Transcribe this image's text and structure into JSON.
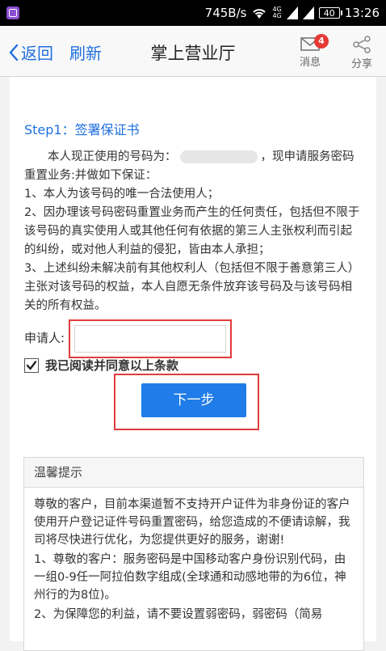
{
  "status_bar": {
    "speed": "745B/s",
    "network_4g_top": "4G",
    "network_4g_bottom": "4G",
    "battery": "40",
    "time": "13:26"
  },
  "header": {
    "back_label": "返回",
    "refresh_label": "刷新",
    "title": "掌上营业厅",
    "message_label": "消息",
    "message_count": "4",
    "share_label": "分享"
  },
  "step": {
    "title": "Step1：签署保证书"
  },
  "agreement": {
    "intro_before": "本人现正使用的号码为：",
    "intro_after": "，现申请服务密码重置业务:并做如下保证：",
    "clause1": "1、本人为该号码的唯一合法使用人；",
    "clause2": "2、因办理该号码密码重置业务而产生的任何责任，包括但不限于该号码的真实使用人或其他任何有依据的第三人主张权利而引起的纠纷，或对他人利益的侵犯，皆由本人承担；",
    "clause3": "3、上述纠纷未解决前有其他权利人（包括但不限于善意第三人）主张对该号码的权益，本人自愿无条件放弃该号码及与该号码相关的所有权益。"
  },
  "form": {
    "applicant_label": "申请人:",
    "applicant_value": "",
    "agree_label": "我已阅读并同意以上条款",
    "agree_checked": true,
    "next_button": "下一步"
  },
  "tips": {
    "title": "温馨提示",
    "p1": "尊敬的客户，目前本渠道暂不支持开户证件为非身份证的客户使用开户登记证件号码重置密码，给您造成的不便请谅解，我司将尽快进行优化，为您提供更好的服务，谢谢!",
    "p2": "1、尊敬的客户：服务密码是中国移动客户身份识别代码，由一组0-9任一阿拉伯数字组成(全球通和动感地带的为6位，神州行的为8位)。",
    "p3": "2、为保障您的利益，请不要设置弱密码，弱密码（简易"
  },
  "colors": {
    "accent": "#1f7ce8",
    "highlight_border": "#e23b3b",
    "badge": "#e53935"
  }
}
